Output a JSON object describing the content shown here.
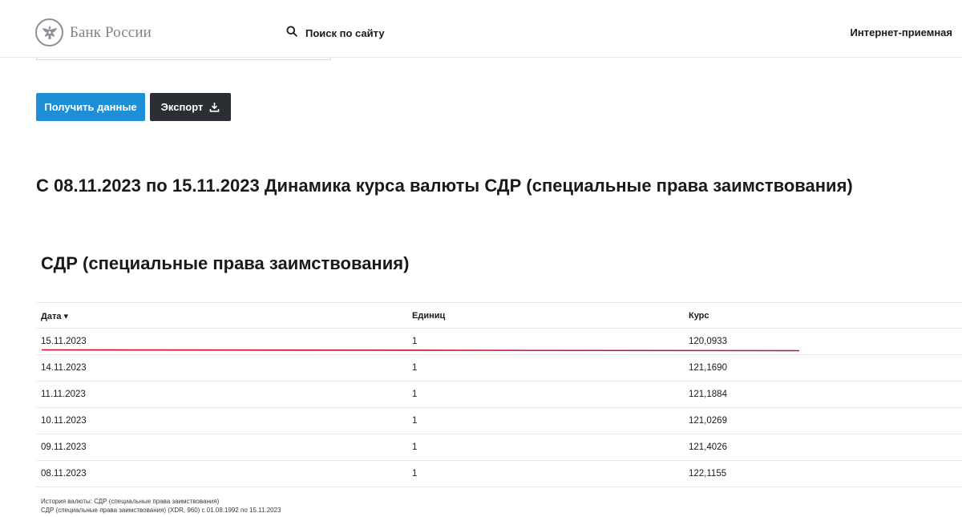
{
  "header": {
    "logo_text": "Банк России",
    "search_label": "Поиск по сайту",
    "reception_label": "Интернет-приемная"
  },
  "buttons": {
    "get_data": "Получить данные",
    "export": "Экспорт"
  },
  "main_title": "С 08.11.2023 по 15.11.2023 Динамика курса валюты СДР (специальные права заимствования)",
  "table": {
    "title": "СДР (специальные права заимствования)",
    "headers": {
      "date": "Дата ▾",
      "units": "Единиц",
      "rate": "Курс"
    },
    "rows": [
      {
        "date": "15.11.2023",
        "units": "1",
        "rate": "120,0933"
      },
      {
        "date": "14.11.2023",
        "units": "1",
        "rate": "121,1690"
      },
      {
        "date": "11.11.2023",
        "units": "1",
        "rate": "121,1884"
      },
      {
        "date": "10.11.2023",
        "units": "1",
        "rate": "121,0269"
      },
      {
        "date": "09.11.2023",
        "units": "1",
        "rate": "121,4026"
      },
      {
        "date": "08.11.2023",
        "units": "1",
        "rate": "122,1155"
      }
    ]
  },
  "footnote": {
    "line1": "История валюты: СДР (специальные права заимствования)",
    "line2": "СДР (специальные права заимствования) (XDR, 960) с 01.08.1992 по 15.11.2023"
  },
  "colors": {
    "primary_button": "#1d8fd6",
    "export_button": "#2b2f33",
    "annotation_underline": "#c8102e"
  }
}
